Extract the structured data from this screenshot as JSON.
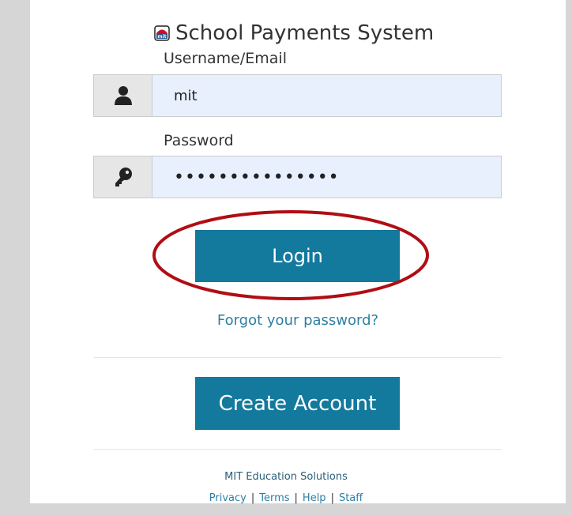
{
  "header": {
    "title": "School Payments System",
    "logo_text": "mit"
  },
  "login_form": {
    "username_label": "Username/Email",
    "username_value": "mit",
    "password_label": "Password",
    "password_value": "•••••••••••••••",
    "login_label": "Login",
    "forgot_label": "Forgot your password?",
    "create_account_label": "Create Account"
  },
  "footer": {
    "company": "MIT Education Solutions",
    "links": [
      "Privacy",
      "Terms",
      "Help",
      "Staff"
    ],
    "separator": "|"
  },
  "colors": {
    "accent": "#13799d",
    "highlight": "#b00d14",
    "link": "#2d7fa2",
    "input_fill": "#e8f0fe"
  },
  "annotations": {
    "highlighted_element": "login-button"
  }
}
